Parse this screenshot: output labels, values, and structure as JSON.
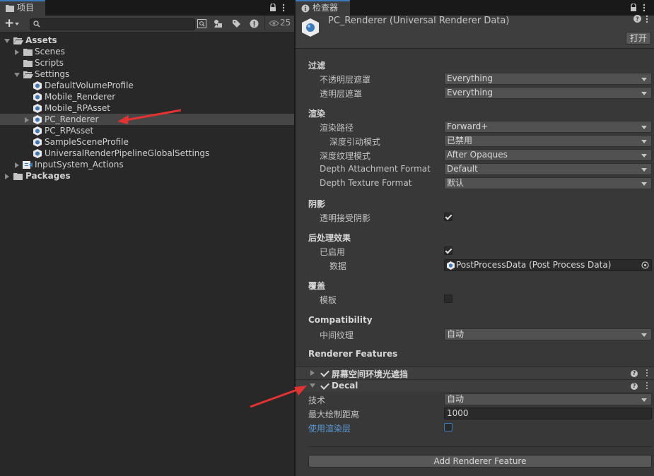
{
  "project_panel": {
    "tab_title": "项目",
    "add_label": "+",
    "hidden_count": "25",
    "search": {
      "value": "",
      "placeholder": ""
    },
    "tree": {
      "assets": "Assets",
      "scenes": "Scenes",
      "scripts": "Scripts",
      "settings": "Settings",
      "default_volume_profile": "DefaultVolumeProfile",
      "mobile_renderer": "Mobile_Renderer",
      "mobile_rpasset": "Mobile_RPAsset",
      "pc_renderer": "PC_Renderer",
      "pc_rpasset": "PC_RPAsset",
      "sample_scene_profile": "SampleSceneProfile",
      "urp_global_settings": "UniversalRenderPipelineGlobalSettings",
      "input_system_actions": "InputSystem_Actions",
      "packages": "Packages"
    }
  },
  "inspector": {
    "tab_title": "检查器",
    "asset_title": "PC_Renderer (Universal Renderer Data)",
    "open_button": "打开",
    "filtering": {
      "title": "过滤",
      "opaque_label": "不透明层遮罩",
      "opaque_value": "Everything",
      "transparent_label": "透明层遮罩",
      "transparent_value": "Everything"
    },
    "rendering": {
      "title": "渲染",
      "path_label": "渲染路径",
      "path_value": "Forward+",
      "depth_priming_label": "深度引动模式",
      "depth_priming_value": "已禁用",
      "depth_texture_mode_label": "深度纹理模式",
      "depth_texture_mode_value": "After Opaques",
      "depth_attachment_label": "Depth Attachment Format",
      "depth_attachment_value": "Default",
      "depth_texture_format_label": "Depth Texture Format",
      "depth_texture_format_value": "默认"
    },
    "shadows": {
      "title": "阴影",
      "transparent_receive_label": "透明接受阴影",
      "transparent_receive_checked": true
    },
    "post_processing": {
      "title": "后处理效果",
      "enabled_label": "已启用",
      "enabled_checked": true,
      "data_label": "数据",
      "data_value": "PostProcessData (Post Process Data)"
    },
    "overrides": {
      "title": "覆盖",
      "stencil_label": "模板",
      "stencil_checked": false
    },
    "compatibility": {
      "title": "Compatibility",
      "intermediate_label": "中间纹理",
      "intermediate_value": "自动"
    },
    "renderer_features": {
      "title": "Renderer Features",
      "ssao_label": "屏幕空间环境光遮挡",
      "ssao_checked": true,
      "decal_label": "Decal",
      "decal_checked": true,
      "technique_label": "技术",
      "technique_value": "自动",
      "max_draw_distance_label": "最大绘制距离",
      "max_draw_distance_value": "1000",
      "use_rendering_layers_label": "使用渲染层",
      "use_rendering_layers_checked": false,
      "add_button": "Add Renderer Feature"
    }
  },
  "colors": {
    "arrow": "#e23232",
    "accent": "#3a79bb",
    "link_label": "#5a9ad8"
  }
}
